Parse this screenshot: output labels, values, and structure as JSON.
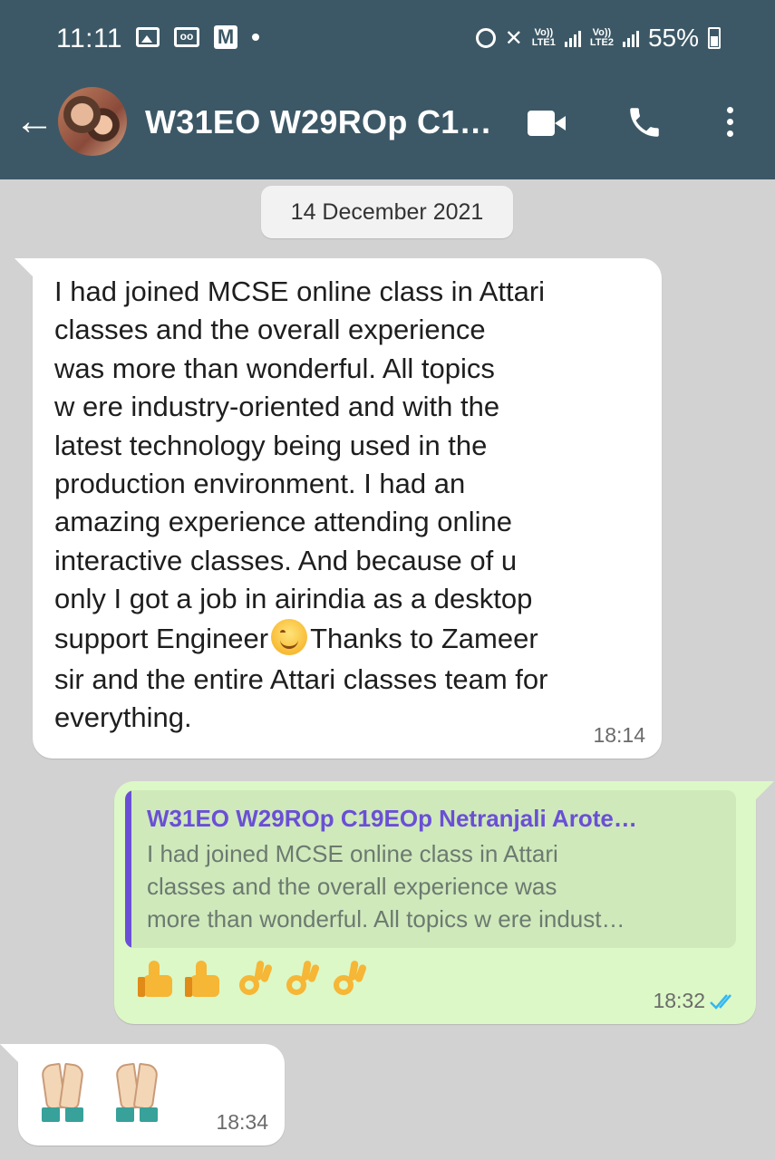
{
  "status_bar": {
    "time": "11:11",
    "battery": "55%",
    "network_1": "LTE1",
    "network_2": "LTE2",
    "volte": "Vo))"
  },
  "chat": {
    "title": "W31EO W29ROp C1…",
    "date_chip": "14 December 2021"
  },
  "messages": [
    {
      "direction": "incoming",
      "lines": [
        "I had joined MCSE online class in Attari",
        "classes and the overall experience",
        "was more than wonderful. All topics",
        "w ere industry-oriented and with the",
        "latest technology being used in the",
        "production environment. I had an",
        "amazing experience attending online",
        "interactive classes. And because of u",
        "only I got a job in airindia as a desktop",
        "support Engineer",
        "Thanks to Zameer",
        "sir and the entire Attari classes team for",
        "everything."
      ],
      "time": "18:14"
    },
    {
      "direction": "outgoing",
      "quote_author": "W31EO W29ROp C19EOp Netranjali Arote…",
      "quote_lines": [
        "I had joined MCSE online class in Attari",
        "classes and the overall experience was",
        "more than wonderful. All topics w ere indust…"
      ],
      "reactions": [
        "thumbs-up",
        "thumbs-up",
        "ok-hand",
        "ok-hand",
        "ok-hand"
      ],
      "time": "18:32",
      "status": "read"
    },
    {
      "direction": "incoming",
      "reactions": [
        "folded-hands",
        "folded-hands"
      ],
      "time": "18:34"
    }
  ],
  "colors": {
    "header": "#3c5866",
    "background": "#d2d2d2",
    "incoming_bubble": "#ffffff",
    "outgoing_bubble": "#dcf8c6",
    "quote_accent": "#6a4fd6",
    "read_ticks": "#34b7f1"
  }
}
